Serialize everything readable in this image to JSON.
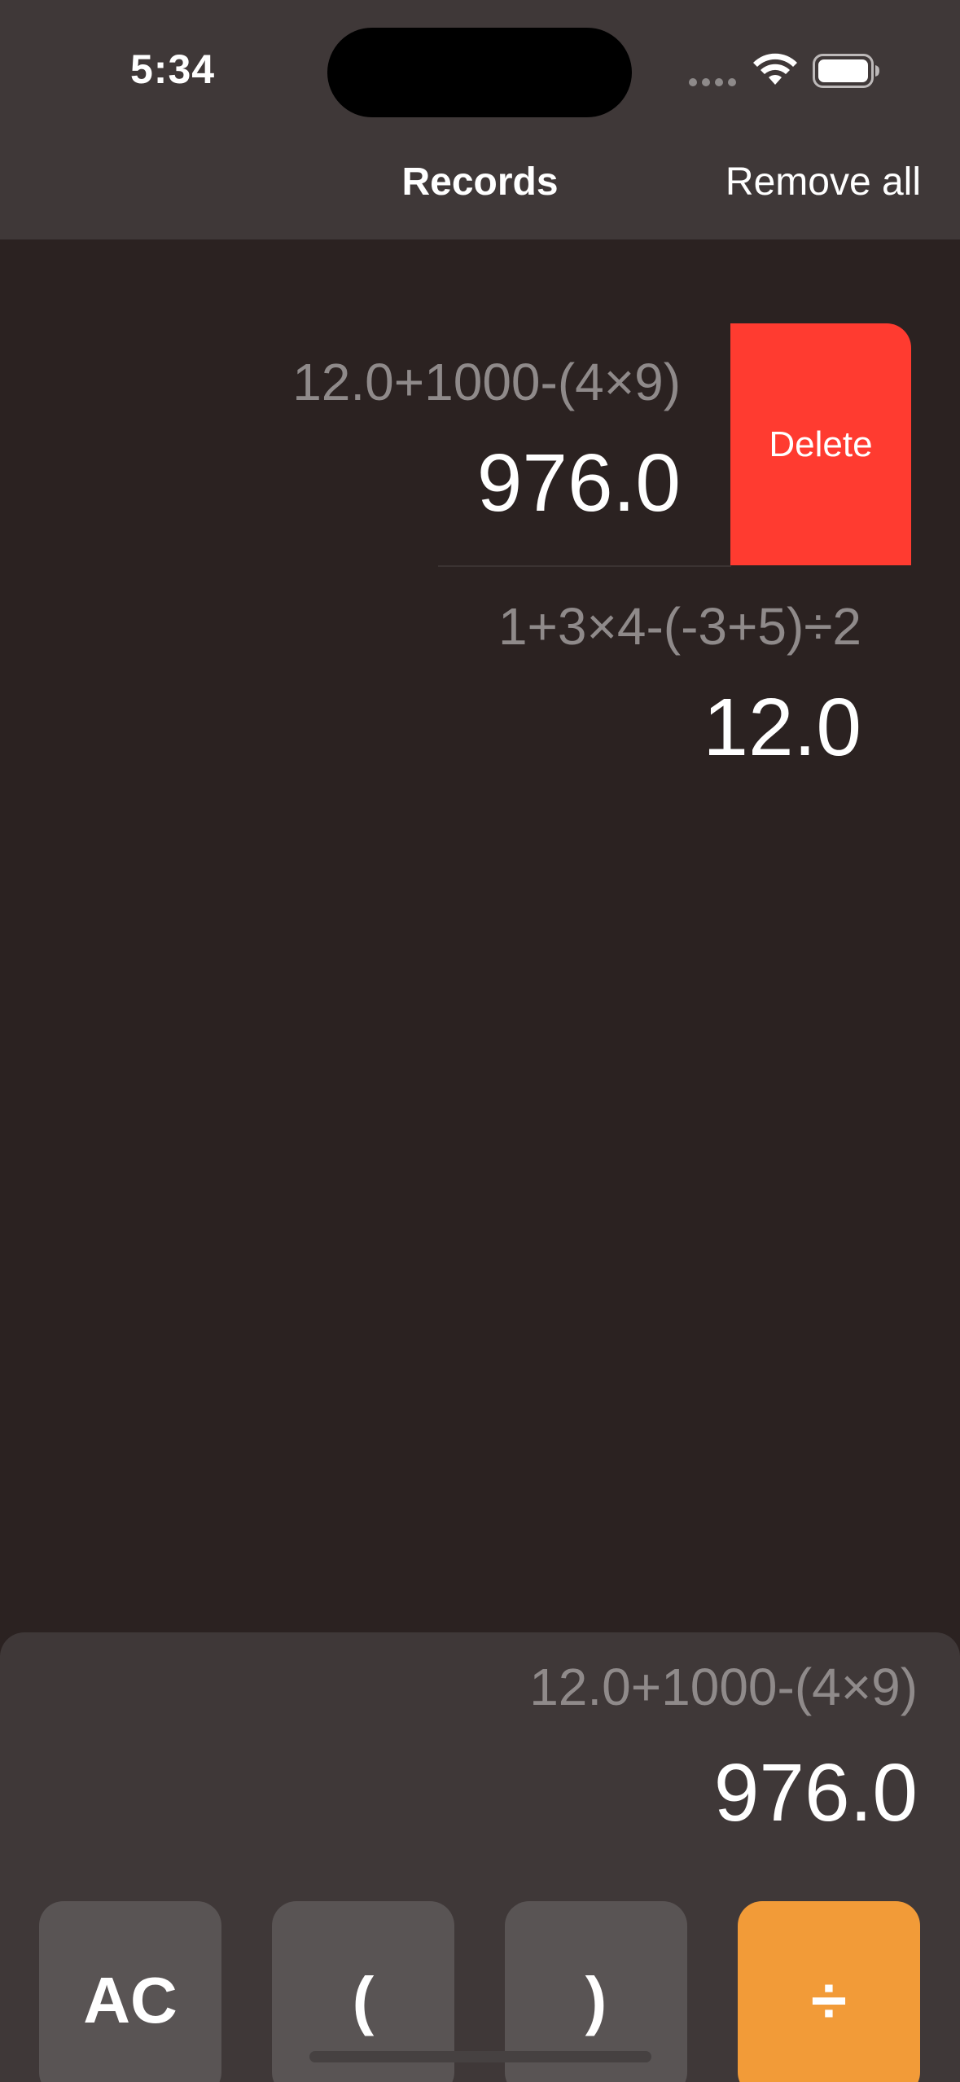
{
  "status_bar": {
    "time": "5:34"
  },
  "nav": {
    "title": "Records",
    "remove_all_label": "Remove all"
  },
  "records": [
    {
      "expression": "12.0+1000-(4×9)",
      "result": "976.0",
      "delete_label": "Delete"
    },
    {
      "expression": "1+3×4-(-3+5)÷2",
      "result": "12.0"
    }
  ],
  "display": {
    "expression": "12.0+1000-(4×9)",
    "result": "976.0"
  },
  "keys": {
    "clear": "AC",
    "open_paren": "(",
    "close_paren": ")",
    "divide": "÷"
  },
  "colors": {
    "background": "#2b2221",
    "header": "#3f3838",
    "delete": "#ff3b30",
    "operator_key": "#f29b38",
    "function_key": "#595454"
  },
  "icons": {
    "wifi": "wifi-icon",
    "battery": "battery-icon",
    "signal": "signal-dots-icon"
  }
}
